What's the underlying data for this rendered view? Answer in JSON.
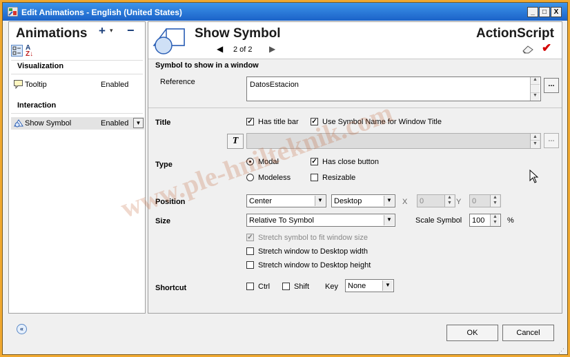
{
  "window": {
    "title": "Edit Animations - English (United States)",
    "buttons": {
      "minimize": "_",
      "maximize": "□",
      "close": "X"
    }
  },
  "left_panel": {
    "heading": "Animations",
    "add_label": "+",
    "add_dropdown": "▾",
    "remove_label": "−",
    "sort_az_top": "A",
    "sort_az_bottom": "Z↓",
    "groups": [
      {
        "label": "Visualization",
        "items": [
          {
            "name": "Tooltip",
            "value": "Enabled"
          }
        ]
      },
      {
        "label": "Interaction",
        "items": [
          {
            "name": "Show Symbol",
            "value": "Enabled"
          }
        ]
      }
    ]
  },
  "header": {
    "title": "Show Symbol",
    "nav_prev": "◀",
    "nav_text": "2 of 2",
    "nav_next": "▶",
    "right_title": "ActionScript",
    "apply_mark": "✔"
  },
  "symbol_section": {
    "title": "Symbol to show in a window",
    "reference_label": "Reference",
    "reference_value": "DatosEstacion",
    "ellipsis": "..."
  },
  "title_section": {
    "label": "Title",
    "has_title_bar": {
      "label": "Has title bar",
      "checked": true
    },
    "use_symbol_name": {
      "label": "Use Symbol Name for Window Title",
      "checked": true
    },
    "tag_icon_text": "T",
    "ellipsis": "..."
  },
  "type_section": {
    "label": "Type",
    "modal": {
      "label": "Modal",
      "selected": true
    },
    "modeless": {
      "label": "Modeless",
      "selected": false
    },
    "has_close_button": {
      "label": "Has close button",
      "checked": true
    },
    "resizable": {
      "label": "Resizable",
      "checked": false
    }
  },
  "position_section": {
    "label": "Position",
    "position_value": "Center",
    "relative_to_value": "Desktop",
    "x_label": "X",
    "x_value": "0",
    "y_label": "Y",
    "y_value": "0"
  },
  "size_section": {
    "label": "Size",
    "size_value": "Relative To Symbol",
    "scale_label": "Scale Symbol",
    "scale_value": "100",
    "scale_unit": "%",
    "stretch_fit": {
      "label": "Stretch symbol to fit window size",
      "checked": true
    },
    "stretch_width": {
      "label": "Stretch window to Desktop width",
      "checked": false
    },
    "stretch_height": {
      "label": "Stretch window to Desktop height",
      "checked": false
    }
  },
  "shortcut_section": {
    "label": "Shortcut",
    "ctrl": {
      "label": "Ctrl",
      "checked": false
    },
    "shift": {
      "label": "Shift",
      "checked": false
    },
    "key_label": "Key",
    "key_value": "None"
  },
  "footer": {
    "collapse_icon": "«",
    "ok_label": "OK",
    "cancel_label": "Cancel"
  },
  "watermark": "www.ple-hnilteknik.com",
  "colors": {
    "title_bar": "#2f7fe0",
    "outer_border": "#f0a830",
    "apply_check": "#d40000"
  }
}
